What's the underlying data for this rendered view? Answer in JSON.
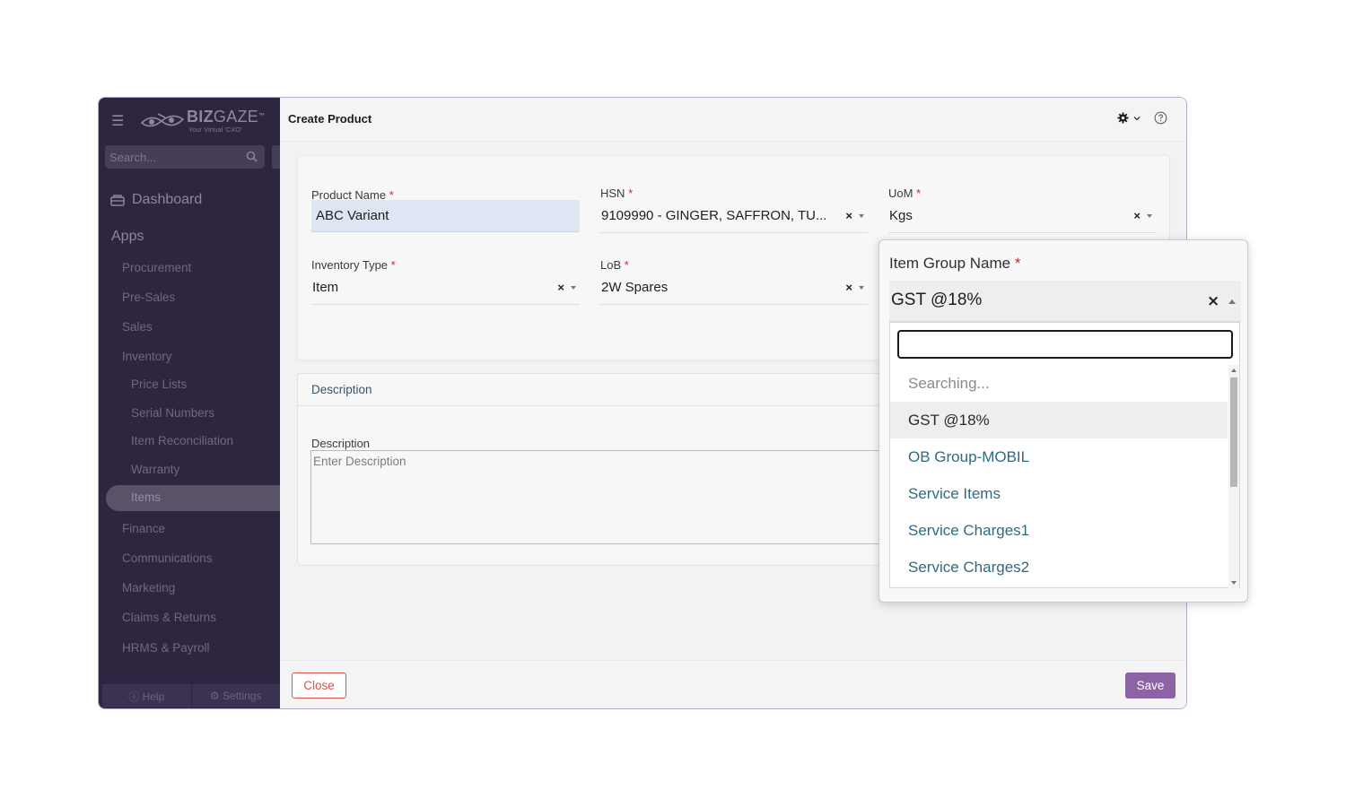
{
  "sidebar": {
    "logo_text_bold": "BIZ",
    "logo_text_light": "GAZE",
    "logo_tm": "™",
    "logo_tagline": "Your Virtual 'CXO'",
    "search_placeholder": "Search...",
    "dashboard_label": "Dashboard",
    "apps_label": "Apps",
    "items": [
      {
        "label": "Procurement"
      },
      {
        "label": "Pre-Sales"
      },
      {
        "label": "Sales"
      },
      {
        "label": "Inventory"
      },
      {
        "label": "Price Lists"
      },
      {
        "label": "Serial Numbers"
      },
      {
        "label": "Item Reconciliation"
      },
      {
        "label": "Warranty"
      },
      {
        "label": "Items"
      },
      {
        "label": "Finance"
      },
      {
        "label": "Communications"
      },
      {
        "label": "Marketing"
      },
      {
        "label": "Claims & Returns"
      },
      {
        "label": "HRMS & Payroll"
      }
    ],
    "footer": {
      "help": "ⓘ Help",
      "settings": "⚙ Settings"
    }
  },
  "header": {
    "title": "Create Product"
  },
  "form": {
    "required_mark": "*",
    "product_name": {
      "label": "Product Name",
      "value": "ABC Variant"
    },
    "hsn": {
      "label": "HSN",
      "value": "9109990 - GINGER, SAFFRON, TU..."
    },
    "uom": {
      "label": "UoM",
      "value": "Kgs"
    },
    "inventory_type": {
      "label": "Inventory Type",
      "value": "Item"
    },
    "lob": {
      "label": "LoB",
      "value": "2W Spares"
    }
  },
  "description_section": {
    "title": "Description",
    "field_label": "Description",
    "placeholder": "Enter Description"
  },
  "footer": {
    "close_label": "Close",
    "save_label": "Save"
  },
  "item_group_dropdown": {
    "label": "Item Group Name",
    "selected": "GST @18%",
    "options": [
      {
        "label": "Searching..."
      },
      {
        "label": "GST @18%"
      },
      {
        "label": "OB Group-MOBIL"
      },
      {
        "label": "Service Items"
      },
      {
        "label": "Service Charges1"
      },
      {
        "label": "Service Charges2"
      }
    ],
    "scroll_position": 0.0
  },
  "colors": {
    "sidebar_bg": "#2e2640",
    "accent": "#8b63a6",
    "danger": "#d9534f",
    "link": "#2f6a7f"
  }
}
